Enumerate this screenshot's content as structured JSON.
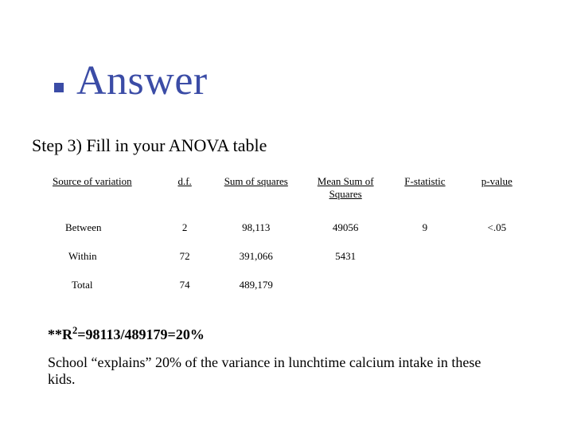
{
  "title": "Answer",
  "step": "Step 3) Fill in your ANOVA table",
  "table": {
    "headers": {
      "source": "Source of variation",
      "df": "d.f.",
      "ss": "Sum of squares",
      "ms": "Mean Sum of Squares",
      "f": "F-statistic",
      "p": "p-value"
    },
    "rows": {
      "between": {
        "label": "Between",
        "df": "2",
        "ss": "98,113",
        "ms": "49056",
        "f": "9",
        "p": "<.05"
      },
      "within": {
        "label": "Within",
        "df": "72",
        "ss": "391,066",
        "ms": "5431",
        "f": "",
        "p": ""
      },
      "total": {
        "label": "Total",
        "df": "74",
        "ss": "489,179",
        "ms": "",
        "f": "",
        "p": ""
      }
    }
  },
  "r2_prefix": "**R",
  "r2_sup": "2",
  "r2_suffix": "=98113/489179=20%",
  "explain": "School “explains” 20% of the variance in lunchtime calcium intake in these kids.",
  "chart_data": {
    "type": "table",
    "title": "ANOVA table",
    "columns": [
      "Source of variation",
      "d.f.",
      "Sum of squares",
      "Mean Sum of Squares",
      "F-statistic",
      "p-value"
    ],
    "rows": [
      [
        "Between",
        2,
        98113,
        49056,
        9,
        "<.05"
      ],
      [
        "Within",
        72,
        391066,
        5431,
        null,
        null
      ],
      [
        "Total",
        74,
        489179,
        null,
        null,
        null
      ]
    ],
    "r_squared": 0.2
  }
}
